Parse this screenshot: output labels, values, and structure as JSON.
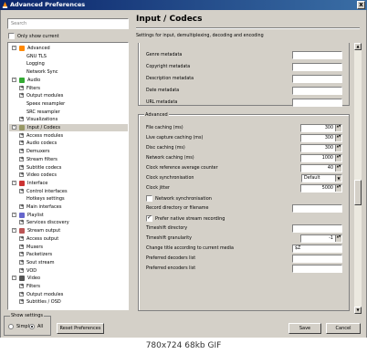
{
  "window": {
    "title": "Advanced Preferences",
    "close_glyph": "x"
  },
  "search": {
    "placeholder": "Search"
  },
  "only_show_current": {
    "label": "Only show current",
    "checked": false
  },
  "tree": [
    {
      "label": "Advanced",
      "depth": 0,
      "expander": "-",
      "icon": "cone-icon",
      "selected": false
    },
    {
      "label": "GNU TLS",
      "depth": 1,
      "expander": "",
      "icon": "",
      "selected": false
    },
    {
      "label": "Logging",
      "depth": 1,
      "expander": "",
      "icon": "",
      "selected": false
    },
    {
      "label": "Network Sync",
      "depth": 1,
      "expander": "",
      "icon": "",
      "selected": false
    },
    {
      "label": "Audio",
      "depth": 0,
      "expander": "-",
      "icon": "audio-icon",
      "selected": false
    },
    {
      "label": "Filters",
      "depth": 1,
      "expander": "+",
      "icon": "",
      "selected": false
    },
    {
      "label": "Output modules",
      "depth": 1,
      "expander": "+",
      "icon": "",
      "selected": false
    },
    {
      "label": "Speex resampler",
      "depth": 1,
      "expander": "",
      "icon": "",
      "selected": false
    },
    {
      "label": "SRC resampler",
      "depth": 1,
      "expander": "",
      "icon": "",
      "selected": false
    },
    {
      "label": "Visualizations",
      "depth": 1,
      "expander": "+",
      "icon": "",
      "selected": false
    },
    {
      "label": "Input / Codecs",
      "depth": 0,
      "expander": "-",
      "icon": "codecs-icon",
      "selected": true
    },
    {
      "label": "Access modules",
      "depth": 1,
      "expander": "+",
      "icon": "",
      "selected": false
    },
    {
      "label": "Audio codecs",
      "depth": 1,
      "expander": "+",
      "icon": "",
      "selected": false
    },
    {
      "label": "Demuxers",
      "depth": 1,
      "expander": "+",
      "icon": "",
      "selected": false
    },
    {
      "label": "Stream filters",
      "depth": 1,
      "expander": "+",
      "icon": "",
      "selected": false
    },
    {
      "label": "Subtitle codecs",
      "depth": 1,
      "expander": "+",
      "icon": "",
      "selected": false
    },
    {
      "label": "Video codecs",
      "depth": 1,
      "expander": "+",
      "icon": "",
      "selected": false
    },
    {
      "label": "Interface",
      "depth": 0,
      "expander": "-",
      "icon": "interface-icon",
      "selected": false
    },
    {
      "label": "Control interfaces",
      "depth": 1,
      "expander": "+",
      "icon": "",
      "selected": false
    },
    {
      "label": "Hotkeys settings",
      "depth": 1,
      "expander": "",
      "icon": "",
      "selected": false
    },
    {
      "label": "Main interfaces",
      "depth": 1,
      "expander": "+",
      "icon": "",
      "selected": false
    },
    {
      "label": "Playlist",
      "depth": 0,
      "expander": "-",
      "icon": "playlist-icon",
      "selected": false
    },
    {
      "label": "Services discovery",
      "depth": 1,
      "expander": "+",
      "icon": "",
      "selected": false
    },
    {
      "label": "Stream output",
      "depth": 0,
      "expander": "-",
      "icon": "stream-icon",
      "selected": false
    },
    {
      "label": "Access output",
      "depth": 1,
      "expander": "+",
      "icon": "",
      "selected": false
    },
    {
      "label": "Muxers",
      "depth": 1,
      "expander": "+",
      "icon": "",
      "selected": false
    },
    {
      "label": "Packetizers",
      "depth": 1,
      "expander": "+",
      "icon": "",
      "selected": false
    },
    {
      "label": "Sout stream",
      "depth": 1,
      "expander": "+",
      "icon": "",
      "selected": false
    },
    {
      "label": "VOD",
      "depth": 1,
      "expander": "+",
      "icon": "",
      "selected": false
    },
    {
      "label": "Video",
      "depth": 0,
      "expander": "-",
      "icon": "video-icon",
      "selected": false
    },
    {
      "label": "Filters",
      "depth": 1,
      "expander": "+",
      "icon": "",
      "selected": false
    },
    {
      "label": "Output modules",
      "depth": 1,
      "expander": "+",
      "icon": "",
      "selected": false
    },
    {
      "label": "Subtitles / OSD",
      "depth": 1,
      "expander": "+",
      "icon": "",
      "selected": false
    }
  ],
  "main": {
    "title": "Input / Codecs",
    "subtitle": "Settings for input, demultiplexing, decoding and encoding"
  },
  "metadata_fields": [
    {
      "label": "Genre metadata",
      "value": ""
    },
    {
      "label": "Copyright metadata",
      "value": ""
    },
    {
      "label": "Description metadata",
      "value": ""
    },
    {
      "label": "Date metadata",
      "value": ""
    },
    {
      "label": "URL metadata",
      "value": ""
    }
  ],
  "advanced": {
    "group_title": "Advanced",
    "spinners": [
      {
        "label": "File caching (ms)",
        "value": "300"
      },
      {
        "label": "Live capture caching (ms)",
        "value": "300"
      },
      {
        "label": "Disc caching (ms)",
        "value": "300"
      },
      {
        "label": "Network caching (ms)",
        "value": "1000"
      },
      {
        "label": "Clock reference average counter",
        "value": "40"
      }
    ],
    "clock_sync": {
      "label": "Clock synchronisation",
      "value": "Default"
    },
    "clock_jitter": {
      "label": "Clock jitter",
      "value": "5000"
    },
    "network_sync": {
      "label": "Network synchronisation",
      "checked": false
    },
    "record_dir": {
      "label": "Record directory or filename",
      "value": ""
    },
    "prefer_native": {
      "label": "Prefer native stream recording",
      "checked": true
    },
    "timeshift_dir": {
      "label": "Timeshift directory",
      "value": ""
    },
    "timeshift_gran": {
      "label": "Timeshift granularity",
      "value": "-1"
    },
    "change_title": {
      "label": "Change title according to current media",
      "value": "$Z"
    },
    "pref_decoders": {
      "label": "Preferred decoders list",
      "value": ""
    },
    "pref_encoders": {
      "label": "Preferred encoders list",
      "value": ""
    }
  },
  "show_settings": {
    "title": "Show settings",
    "simple": "Simple",
    "all": "All",
    "selected": "All"
  },
  "buttons": {
    "reset": "Reset Preferences",
    "save": "Save",
    "cancel": "Cancel"
  },
  "caption": "780x724  68kb  GIF"
}
